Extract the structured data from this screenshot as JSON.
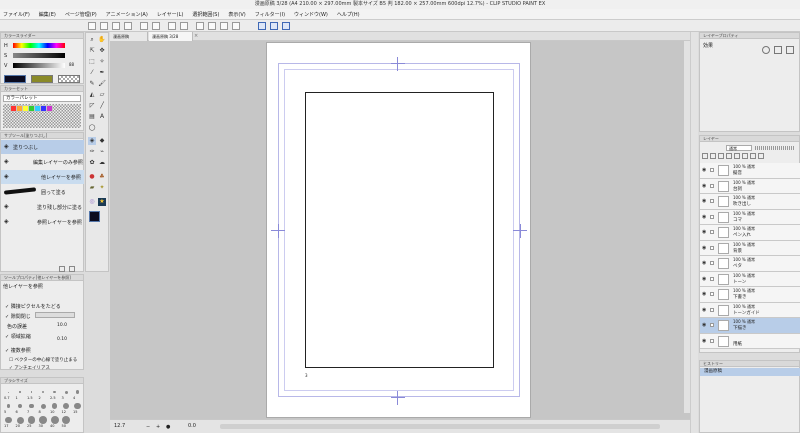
{
  "title": "漫画原稿 3/28 (A4 210.00 × 297.00mm 製本サイズ B5 判 182.00 × 257.00mm 600dpi 12.7%) - CLIP STUDIO PAINT EX",
  "menu": [
    "ファイル(F)",
    "編集(E)",
    "ページ管理(P)",
    "アニメーション(A)",
    "レイヤー(L)",
    "選択範囲(S)",
    "表示(V)",
    "フィルター(I)",
    "ウィンドウ(W)",
    "ヘルプ(H)"
  ],
  "color_wheel": {
    "title": "カラースライダー",
    "labels": [
      "H",
      "S",
      "V"
    ],
    "values": [
      "",
      "",
      "88"
    ]
  },
  "color_set": {
    "title": "カラーセット",
    "palette": "カラーパレット"
  },
  "subtool": {
    "title": "サブツール[塗りつぶし]",
    "items": [
      "塗りつぶし",
      "編集レイヤーのみ参照",
      "他レイヤーを参照",
      "囲って塗る",
      "塗り残し部分に塗る",
      "参照レイヤーを参照"
    ]
  },
  "toolprop": {
    "title": "ツールプロパティ[他レイヤーを参照]",
    "name": "他レイヤーを参照",
    "rows": [
      "隣接ピクセルをたどる",
      "隙間閉じ",
      "色の誤差",
      "領域拡縮",
      "複数参照",
      "ベクターの中心線で塗り止まる"
    ],
    "values": [
      "",
      "",
      "10.0",
      "0.10"
    ],
    "extra": "アンチエイリアス"
  },
  "brush_size": {
    "title": "ブラシサイズ",
    "sizes": [
      "0.7",
      "1",
      "1.5",
      "2",
      "2.5",
      "3",
      "4",
      "5",
      "6",
      "7",
      "8",
      "10",
      "12",
      "15",
      "17",
      "20",
      "25",
      "30",
      "40",
      "50"
    ]
  },
  "tabs": [
    {
      "label": "漫画原稿"
    },
    {
      "label": "漫画原稿 3/28"
    }
  ],
  "canvas": {
    "page_number": "3",
    "zoom": "12.7",
    "angle": "0.0"
  },
  "layer_prop": {
    "title": "レイヤープロパティ",
    "effect_label": "効果"
  },
  "layer_panel": {
    "title": "レイヤー",
    "blend": "通常",
    "opacity": "100",
    "layers": [
      {
        "pct": "100 % 通常",
        "name": "擬音"
      },
      {
        "pct": "100 % 通常",
        "name": "台詞"
      },
      {
        "pct": "100 % 通常",
        "name": "吹き出し"
      },
      {
        "pct": "100 % 通常",
        "name": "コマ"
      },
      {
        "pct": "100 % 通常",
        "name": "ペン入れ"
      },
      {
        "pct": "100 % 通常",
        "name": "背景"
      },
      {
        "pct": "100 % 通常",
        "name": "ベタ"
      },
      {
        "pct": "100 % 通常",
        "name": "トーン"
      },
      {
        "pct": "100 % 通常",
        "name": "下書き"
      },
      {
        "pct": "100 % 通常",
        "name": "トーンガイド"
      },
      {
        "pct": "100 % 通常",
        "name": "下描き"
      },
      {
        "pct": "",
        "name": "用紙"
      }
    ]
  },
  "history": {
    "title": "ヒストリー",
    "item": "漫画原稿"
  }
}
